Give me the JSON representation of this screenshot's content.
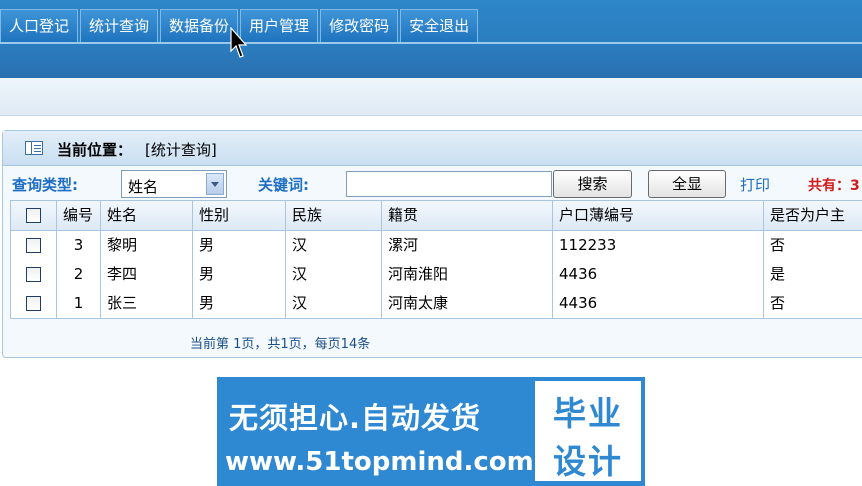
{
  "nav": {
    "tabs": [
      "人口登记",
      "统计查询",
      "数据备份",
      "用户管理",
      "修改密码",
      "安全退出"
    ]
  },
  "panel": {
    "location_label": "当前位置：",
    "location_value": "[统计查询]"
  },
  "search": {
    "type_label": "查询类型:",
    "type_selected": "姓名",
    "keyword_label": "关键词:",
    "keyword_value": "",
    "search_button": "搜索",
    "show_all_button": "全显",
    "print_link": "打印",
    "total_text": "共有：3"
  },
  "table": {
    "columns": [
      "编号",
      "姓名",
      "性别",
      "民族",
      "籍贯",
      "户口薄编号",
      "是否为户主"
    ],
    "rows": [
      [
        "3",
        "黎明",
        "男",
        "汉",
        "漯河",
        "112233",
        "否"
      ],
      [
        "2",
        "李四",
        "男",
        "汉",
        "河南淮阳",
        "4436",
        "是"
      ],
      [
        "1",
        "张三",
        "男",
        "汉",
        "河南太康",
        "4436",
        "否"
      ]
    ]
  },
  "pager_text": "当前第  1页，共1页，每页14条",
  "banner": {
    "headline": "无须担心.自动发货",
    "url": "www.51topmind.com",
    "box_line1": "毕业",
    "box_line2": "设计"
  },
  "colors": {
    "nav_blue": "#2b7ec0",
    "label_blue": "#1e6fc4",
    "total_red": "#d11a1a",
    "banner_blue": "#2e88d2"
  }
}
